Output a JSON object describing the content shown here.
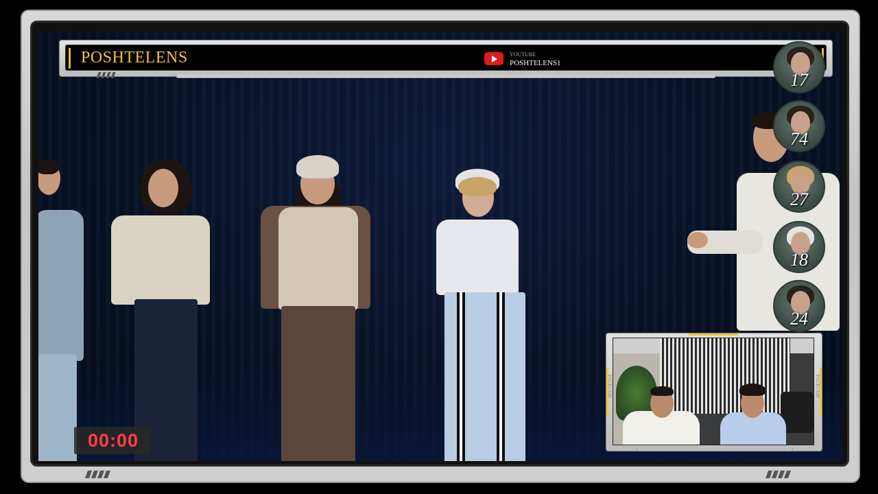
{
  "overlay": {
    "channel_name": "POSHTELENS",
    "youtube_label": "YOUTUBE",
    "youtube_handle": "POSHTELENS1",
    "accent_color": "#f2c23c",
    "youtube_color": "#e01b1b"
  },
  "rankings": [
    {
      "number": "17",
      "icon": "contestant-avatar"
    },
    {
      "number": "74",
      "icon": "contestant-avatar"
    },
    {
      "number": "27",
      "icon": "contestant-avatar"
    },
    {
      "number": "18",
      "icon": "contestant-avatar"
    },
    {
      "number": "24",
      "icon": "contestant-avatar"
    }
  ],
  "timer": {
    "value": "00:00",
    "color": "#ff4040"
  },
  "facecam": {
    "label_left": "FACECAM",
    "label_right": "FACECAM"
  }
}
